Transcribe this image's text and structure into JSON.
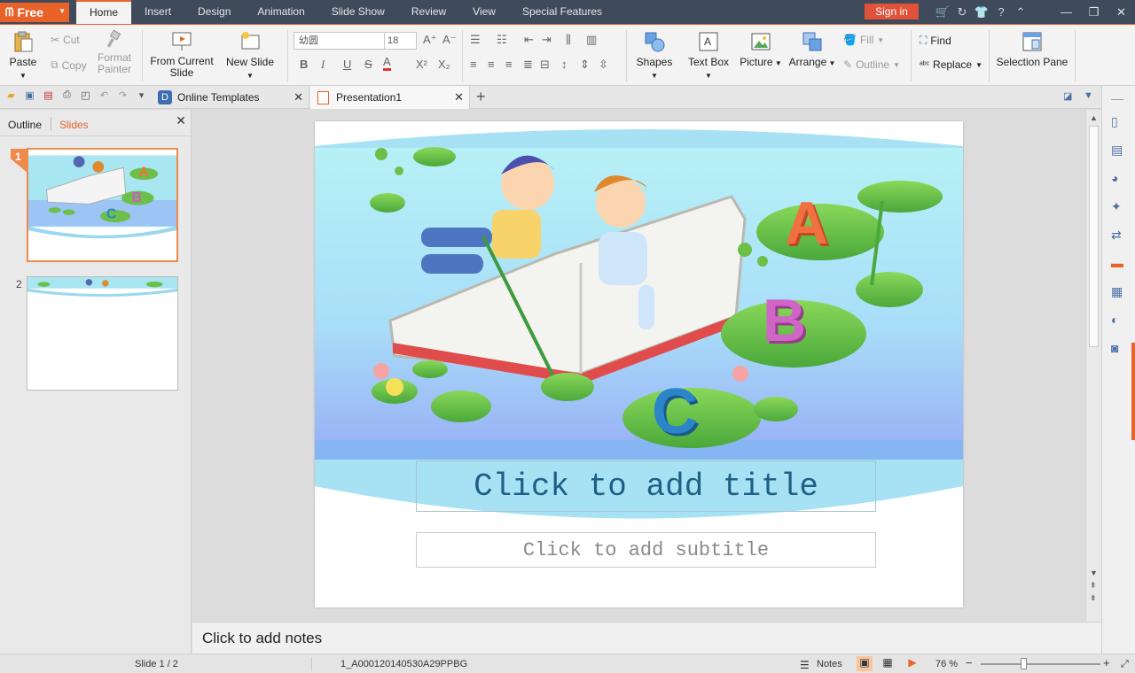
{
  "app": {
    "logo_label": "Free",
    "menu_tabs": [
      "Home",
      "Insert",
      "Design",
      "Animation",
      "Slide Show",
      "Review",
      "View",
      "Special Features"
    ],
    "active_tab": "Home",
    "sign_in_label": "Sign in"
  },
  "ribbon": {
    "paste_label": "Paste",
    "cut_label": "Cut",
    "copy_label": "Copy",
    "format_painter_label": "Format Painter",
    "from_current_slide_label": "From Current Slide",
    "new_slide_label": "New Slide",
    "font_name": "幼圆",
    "font_size": "18",
    "shapes_label": "Shapes",
    "textbox_label": "Text Box",
    "picture_label": "Picture",
    "arrange_label": "Arrange",
    "fill_label": "Fill",
    "outline_label": "Outline",
    "find_label": "Find",
    "replace_label": "Replace",
    "selection_pane_label": "Selection Pane"
  },
  "tabs": {
    "online_templates": "Online Templates",
    "presentation": "Presentation1"
  },
  "left_pane": {
    "outline_tab": "Outline",
    "slides_tab": "Slides",
    "slide_numbers": [
      "1",
      "2"
    ]
  },
  "slide": {
    "title_placeholder": "Click to add title",
    "subtitle_placeholder": "Click to add subtitle",
    "letters": [
      "A",
      "B",
      "C"
    ]
  },
  "notes": {
    "placeholder": "Click to add notes"
  },
  "status": {
    "slide_counter": "Slide 1 / 2",
    "template_name": "1_A000120140530A29PPBG",
    "notes_label": "Notes",
    "zoom": "76 %"
  },
  "colors": {
    "accent": "#e8622a",
    "menubar": "#3f4a5a",
    "sky": "#a8e6f2",
    "title_text": "#1f5f86"
  }
}
